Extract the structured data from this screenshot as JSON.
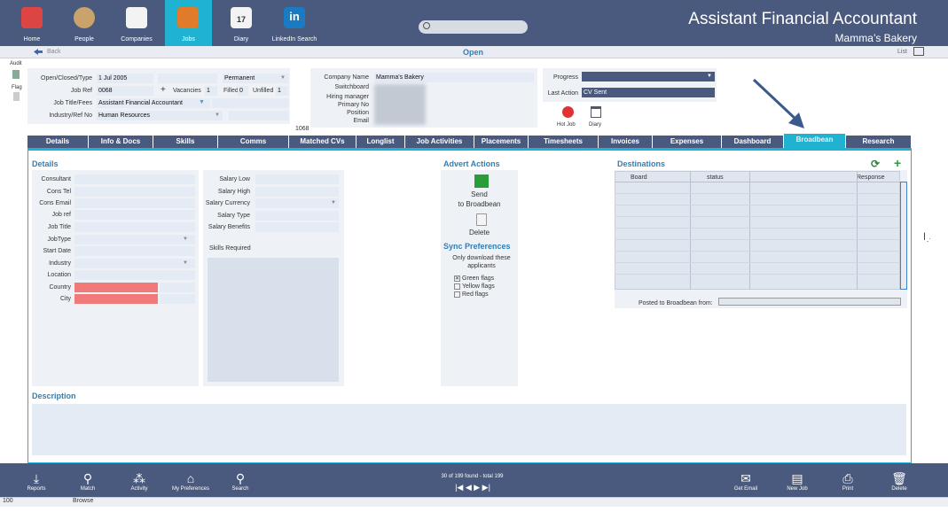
{
  "nav": [
    {
      "label": "Home",
      "icon": "house-icon"
    },
    {
      "label": "People",
      "icon": "people-icon"
    },
    {
      "label": "Companies",
      "icon": "companies-icon"
    },
    {
      "label": "Jobs",
      "icon": "jobs-briefcase-icon"
    },
    {
      "label": "Diary",
      "icon": "calendar-icon"
    },
    {
      "label": "LinkedIn Search",
      "icon": "linkedin-icon"
    }
  ],
  "header": {
    "title": "Assistant Financial Accountant",
    "subtitle": "Mamma’s Bakery",
    "linkedin_glyph": "in",
    "diary_glyph": "17"
  },
  "subbar": {
    "back": "Back",
    "status": "Open",
    "list": "List"
  },
  "sidebar": {
    "audit": "Audit",
    "flag": "Flag"
  },
  "job": {
    "open_label": "Open/Closed/Type",
    "open_date": "1 Jul 2005",
    "type": "Permanent",
    "jobref_label": "Job Ref",
    "jobref": "0068",
    "plus": "+",
    "vacancies_label": "Vacancies",
    "vacancies": "1",
    "filled_label": "Filled",
    "filled": "0",
    "unfilled_label": "Unfilled",
    "unfilled": "1",
    "title_label": "Job Title/Fees",
    "title": "Assistant Financial Accountant",
    "industry_label": "Industry/Ref No",
    "industry": "Human Resources",
    "refno": "1068"
  },
  "company": {
    "name_label": "Company Name",
    "name": "Mamma's Bakery",
    "switchboard_label": "Switchboard",
    "hiring_label": "Hiring manager",
    "primary_label": "Primary No",
    "position_label": "Position",
    "email_label": "Email"
  },
  "progress": {
    "progress_label": "Progress",
    "last_action_label": "Last Action",
    "last_action": "CV Sent",
    "hotjob": "Hot Job",
    "diary": "Diary"
  },
  "tabs": [
    "Details",
    "Info & Docs",
    "Skills",
    "Comms",
    "Matched CVs",
    "Longlist",
    "Job Activities",
    "Placements",
    "Timesheets",
    "Invoices",
    "Expenses",
    "Dashboard",
    "Broadbean",
    "Research"
  ],
  "details": {
    "title": "Details",
    "fields": [
      "Consultant",
      "Cons Tel",
      "Cons Email",
      "Job ref",
      "Job Title",
      "JobType",
      "Start Date",
      "Industry",
      "Location",
      "Country",
      "City"
    ],
    "salary": [
      "Salary Low",
      "Salary High",
      "Salary Currency",
      "Salary Type",
      "Salary Benefits"
    ],
    "skills": "Skills Required"
  },
  "advert": {
    "title": "Advert Actions",
    "send": "Send",
    "send2": "to Broadbean",
    "delete": "Delete",
    "sync": "Sync Preferences",
    "only": "Only download these",
    "applicants": "applicants",
    "green": "Green flags",
    "yellow": "Yellow flags",
    "red": "Red flags",
    "check": "✕"
  },
  "destinations": {
    "title": "Destinations",
    "cols": [
      "Board",
      "status",
      "",
      "Response"
    ],
    "posted": "Posted to Broadbean from:"
  },
  "description": {
    "title": "Description"
  },
  "bottom": {
    "items": [
      {
        "label": "Reports",
        "glyph": "⤓"
      },
      {
        "label": "Match",
        "glyph": "⚲"
      },
      {
        "label": "Activity",
        "glyph": "⁂"
      },
      {
        "label": "My Preferences",
        "glyph": "⌂"
      },
      {
        "label": "Search",
        "glyph": "⚲"
      }
    ],
    "right": [
      {
        "label": "Get Email",
        "glyph": "✉"
      },
      {
        "label": "New Job",
        "glyph": "▤"
      },
      {
        "label": "Print",
        "glyph": "⎙"
      },
      {
        "label": "Delete",
        "glyph": "🗑"
      }
    ],
    "found": "30 of 199 found - total 199",
    "pager": "|◀ ◀ ▶ ▶|"
  },
  "status": {
    "zoom": "100",
    "mode": "Browse"
  }
}
